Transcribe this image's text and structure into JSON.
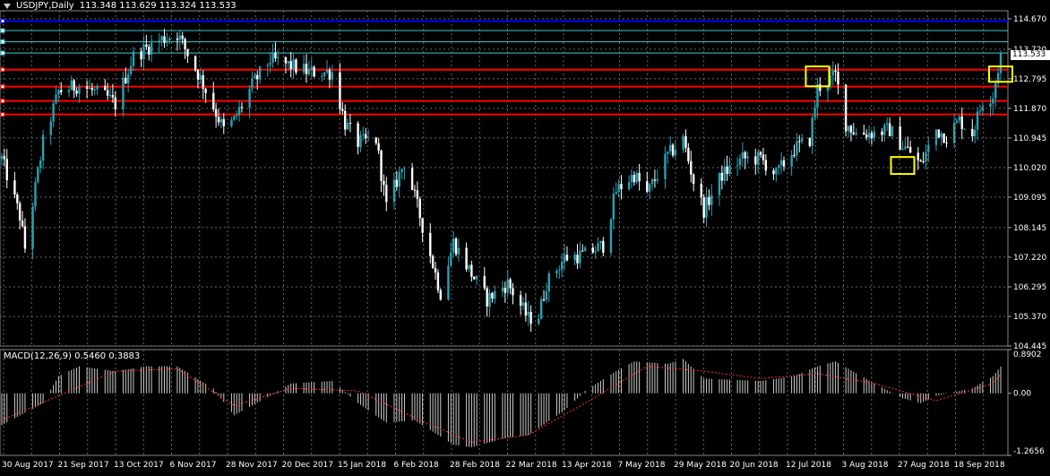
{
  "header": {
    "symbol": "USDJPY,Daily",
    "ohlc": "113.348 113.629 113.324 113.533"
  },
  "macd": {
    "label": "MACD(12,26,9) 0.5460 0.3883",
    "ticks": [
      "0.8902",
      "0.00",
      "-1.2656"
    ]
  },
  "colors": {
    "background": "#000000",
    "grid": "#666666",
    "bull": "#2aa1b2",
    "bear": "#ffffff",
    "support_red": "#ff0000",
    "blue_line": "#0000ff",
    "cyan_line": "#40c8d0",
    "highlight_box": "#ffff00",
    "signal": "#ff3030"
  },
  "chart_data": [
    {
      "type": "candlestick",
      "symbol": "USDJPY",
      "timeframe": "Daily",
      "last_price": "113.533",
      "y_tick_labels": [
        "114.670",
        "113.720",
        "112.795",
        "111.870",
        "110.945",
        "110.020",
        "109.095",
        "108.145",
        "107.220",
        "106.295",
        "105.370",
        "104.445"
      ],
      "ylim": [
        104.445,
        114.92
      ],
      "x_tick_labels": [
        "30 Aug 2017",
        "21 Sep 2017",
        "13 Oct 2017",
        "6 Nov 2017",
        "28 Nov 2017",
        "20 Dec 2017",
        "15 Jan 2018",
        "6 Feb 2018",
        "28 Feb 2018",
        "22 Mar 2018",
        "13 Apr 2018",
        "7 May 2018",
        "29 May 2018",
        "20 Jun 2018",
        "12 Jul 2018",
        "3 Aug 2018",
        "27 Aug 2018",
        "18 Sep 2018"
      ],
      "grid": true,
      "horizontal_lines": [
        {
          "price": 114.6,
          "color": "#0000ff"
        },
        {
          "price": 114.3,
          "color": "#40c8d0"
        },
        {
          "price": 113.95,
          "color": "#40c8d0"
        },
        {
          "price": 113.6,
          "color": "#40c8d0"
        },
        {
          "price": 113.08,
          "color": "#ff0000"
        },
        {
          "price": 112.55,
          "color": "#ff0000"
        },
        {
          "price": 112.1,
          "color": "#ff0000"
        },
        {
          "price": 111.68,
          "color": "#ff0000"
        }
      ],
      "highlight_boxes": [
        {
          "date": "12 Jul 2018",
          "high": 113.18,
          "low": 112.56
        },
        {
          "date": "14 Aug 2018",
          "high": 110.35,
          "low": 109.82
        },
        {
          "date": "21 Sep 2018",
          "high": 113.18,
          "low": 112.7
        }
      ],
      "price_path": [
        {
          "date": "30 Aug 2017",
          "close": 110.3
        },
        {
          "date": "6 Sep 2017",
          "close": 108.5
        },
        {
          "date": "8 Sep 2017",
          "close": 107.5
        },
        {
          "date": "15 Sep 2017",
          "close": 110.8
        },
        {
          "date": "21 Sep 2017",
          "close": 112.4
        },
        {
          "date": "29 Sep 2017",
          "close": 112.6
        },
        {
          "date": "10 Oct 2017",
          "close": 112.2
        },
        {
          "date": "13 Oct 2017",
          "close": 112.0
        },
        {
          "date": "20 Oct 2017",
          "close": 113.5
        },
        {
          "date": "30 Oct 2017",
          "close": 114.0
        },
        {
          "date": "6 Nov 2017",
          "close": 114.2
        },
        {
          "date": "15 Nov 2017",
          "close": 112.8
        },
        {
          "date": "24 Nov 2017",
          "close": 111.2
        },
        {
          "date": "28 Nov 2017",
          "close": 111.5
        },
        {
          "date": "5 Dec 2017",
          "close": 112.6
        },
        {
          "date": "12 Dec 2017",
          "close": 113.4
        },
        {
          "date": "20 Dec 2017",
          "close": 113.2
        },
        {
          "date": "27 Dec 2017",
          "close": 113.0
        },
        {
          "date": "5 Jan 2018",
          "close": 113.0
        },
        {
          "date": "10 Jan 2018",
          "close": 111.4
        },
        {
          "date": "15 Jan 2018",
          "close": 110.8
        },
        {
          "date": "22 Jan 2018",
          "close": 110.9
        },
        {
          "date": "26 Jan 2018",
          "close": 108.8
        },
        {
          "date": "2 Feb 2018",
          "close": 110.2
        },
        {
          "date": "6 Feb 2018",
          "close": 109.1
        },
        {
          "date": "16 Feb 2018",
          "close": 106.1
        },
        {
          "date": "21 Feb 2018",
          "close": 107.7
        },
        {
          "date": "28 Feb 2018",
          "close": 106.7
        },
        {
          "date": "6 Mar 2018",
          "close": 105.9
        },
        {
          "date": "14 Mar 2018",
          "close": 106.4
        },
        {
          "date": "22 Mar 2018",
          "close": 105.3
        },
        {
          "date": "26 Mar 2018",
          "close": 105.4
        },
        {
          "date": "29 Mar 2018",
          "close": 106.4
        },
        {
          "date": "5 Apr 2018",
          "close": 107.2
        },
        {
          "date": "13 Apr 2018",
          "close": 107.3
        },
        {
          "date": "20 Apr 2018",
          "close": 107.6
        },
        {
          "date": "25 Apr 2018",
          "close": 109.3
        },
        {
          "date": "2 May 2018",
          "close": 109.8
        },
        {
          "date": "7 May 2018",
          "close": 109.2
        },
        {
          "date": "15 May 2018",
          "close": 110.4
        },
        {
          "date": "21 May 2018",
          "close": 110.9
        },
        {
          "date": "25 May 2018",
          "close": 109.6
        },
        {
          "date": "29 May 2018",
          "close": 108.7
        },
        {
          "date": "5 Jun 2018",
          "close": 109.8
        },
        {
          "date": "13 Jun 2018",
          "close": 110.3
        },
        {
          "date": "20 Jun 2018",
          "close": 110.3
        },
        {
          "date": "26 Jun 2018",
          "close": 109.8
        },
        {
          "date": "3 Jul 2018",
          "close": 110.6
        },
        {
          "date": "9 Jul 2018",
          "close": 110.9
        },
        {
          "date": "12 Jul 2018",
          "close": 112.5
        },
        {
          "date": "19 Jul 2018",
          "close": 112.9
        },
        {
          "date": "23 Jul 2018",
          "close": 111.4
        },
        {
          "date": "27 Jul 2018",
          "close": 111.1
        },
        {
          "date": "3 Aug 2018",
          "close": 111.1
        },
        {
          "date": "9 Aug 2018",
          "close": 111.2
        },
        {
          "date": "14 Aug 2018",
          "close": 110.7
        },
        {
          "date": "17 Aug 2018",
          "close": 110.5
        },
        {
          "date": "21 Aug 2018",
          "close": 110.1
        },
        {
          "date": "27 Aug 2018",
          "close": 111.2
        },
        {
          "date": "31 Aug 2018",
          "close": 111.0
        },
        {
          "date": "5 Sep 2018",
          "close": 111.5
        },
        {
          "date": "10 Sep 2018",
          "close": 111.1
        },
        {
          "date": "14 Sep 2018",
          "close": 112.1
        },
        {
          "date": "18 Sep 2018",
          "close": 112.3
        },
        {
          "date": "21 Sep 2018",
          "close": 113.533
        }
      ]
    },
    {
      "type": "bar",
      "indicator": "MACD(12,26,9)",
      "macd_value": 0.546,
      "signal_value": 0.3883,
      "ylim": [
        -1.2656,
        0.8902
      ],
      "histogram_path": [
        {
          "date": "30 Aug 2017",
          "value": -0.65
        },
        {
          "date": "15 Sep 2017",
          "value": -0.2
        },
        {
          "date": "21 Sep 2017",
          "value": 0.35
        },
        {
          "date": "29 Sep 2017",
          "value": 0.55
        },
        {
          "date": "13 Oct 2017",
          "value": 0.45
        },
        {
          "date": "25 Oct 2017",
          "value": 0.55
        },
        {
          "date": "6 Nov 2017",
          "value": 0.55
        },
        {
          "date": "20 Nov 2017",
          "value": 0.1
        },
        {
          "date": "28 Nov 2017",
          "value": -0.45
        },
        {
          "date": "12 Dec 2017",
          "value": -0.05
        },
        {
          "date": "20 Dec 2017",
          "value": 0.2
        },
        {
          "date": "5 Jan 2018",
          "value": 0.25
        },
        {
          "date": "15 Jan 2018",
          "value": -0.2
        },
        {
          "date": "26 Jan 2018",
          "value": -0.6
        },
        {
          "date": "6 Feb 2018",
          "value": -0.55
        },
        {
          "date": "21 Feb 2018",
          "value": -1.05
        },
        {
          "date": "28 Feb 2018",
          "value": -1.1
        },
        {
          "date": "14 Mar 2018",
          "value": -0.9
        },
        {
          "date": "22 Mar 2018",
          "value": -0.85
        },
        {
          "date": "5 Apr 2018",
          "value": -0.35
        },
        {
          "date": "13 Apr 2018",
          "value": 0.05
        },
        {
          "date": "25 Apr 2018",
          "value": 0.45
        },
        {
          "date": "2 May 2018",
          "value": 0.65
        },
        {
          "date": "15 May 2018",
          "value": 0.6
        },
        {
          "date": "21 May 2018",
          "value": 0.7
        },
        {
          "date": "29 May 2018",
          "value": 0.3
        },
        {
          "date": "20 Jun 2018",
          "value": 0.25
        },
        {
          "date": "3 Jul 2018",
          "value": 0.35
        },
        {
          "date": "12 Jul 2018",
          "value": 0.55
        },
        {
          "date": "19 Jul 2018",
          "value": 0.65
        },
        {
          "date": "3 Aug 2018",
          "value": 0.2
        },
        {
          "date": "14 Aug 2018",
          "value": -0.1
        },
        {
          "date": "21 Aug 2018",
          "value": -0.2
        },
        {
          "date": "27 Aug 2018",
          "value": -0.05
        },
        {
          "date": "10 Sep 2018",
          "value": 0.1
        },
        {
          "date": "18 Sep 2018",
          "value": 0.35
        },
        {
          "date": "21 Sep 2018",
          "value": 0.546
        }
      ],
      "signal_path": [
        {
          "date": "30 Aug 2017",
          "value": -0.55
        },
        {
          "date": "21 Sep 2017",
          "value": -0.05
        },
        {
          "date": "13 Oct 2017",
          "value": 0.45
        },
        {
          "date": "6 Nov 2017",
          "value": 0.5
        },
        {
          "date": "28 Nov 2017",
          "value": -0.25
        },
        {
          "date": "20 Dec 2017",
          "value": 0.1
        },
        {
          "date": "15 Jan 2018",
          "value": 0.05
        },
        {
          "date": "6 Feb 2018",
          "value": -0.5
        },
        {
          "date": "28 Feb 2018",
          "value": -1.0
        },
        {
          "date": "22 Mar 2018",
          "value": -0.85
        },
        {
          "date": "13 Apr 2018",
          "value": -0.2
        },
        {
          "date": "7 May 2018",
          "value": 0.55
        },
        {
          "date": "29 May 2018",
          "value": 0.45
        },
        {
          "date": "20 Jun 2018",
          "value": 0.3
        },
        {
          "date": "12 Jul 2018",
          "value": 0.4
        },
        {
          "date": "3 Aug 2018",
          "value": 0.2
        },
        {
          "date": "27 Aug 2018",
          "value": -0.15
        },
        {
          "date": "18 Sep 2018",
          "value": 0.2
        },
        {
          "date": "21 Sep 2018",
          "value": 0.3883
        }
      ]
    }
  ]
}
